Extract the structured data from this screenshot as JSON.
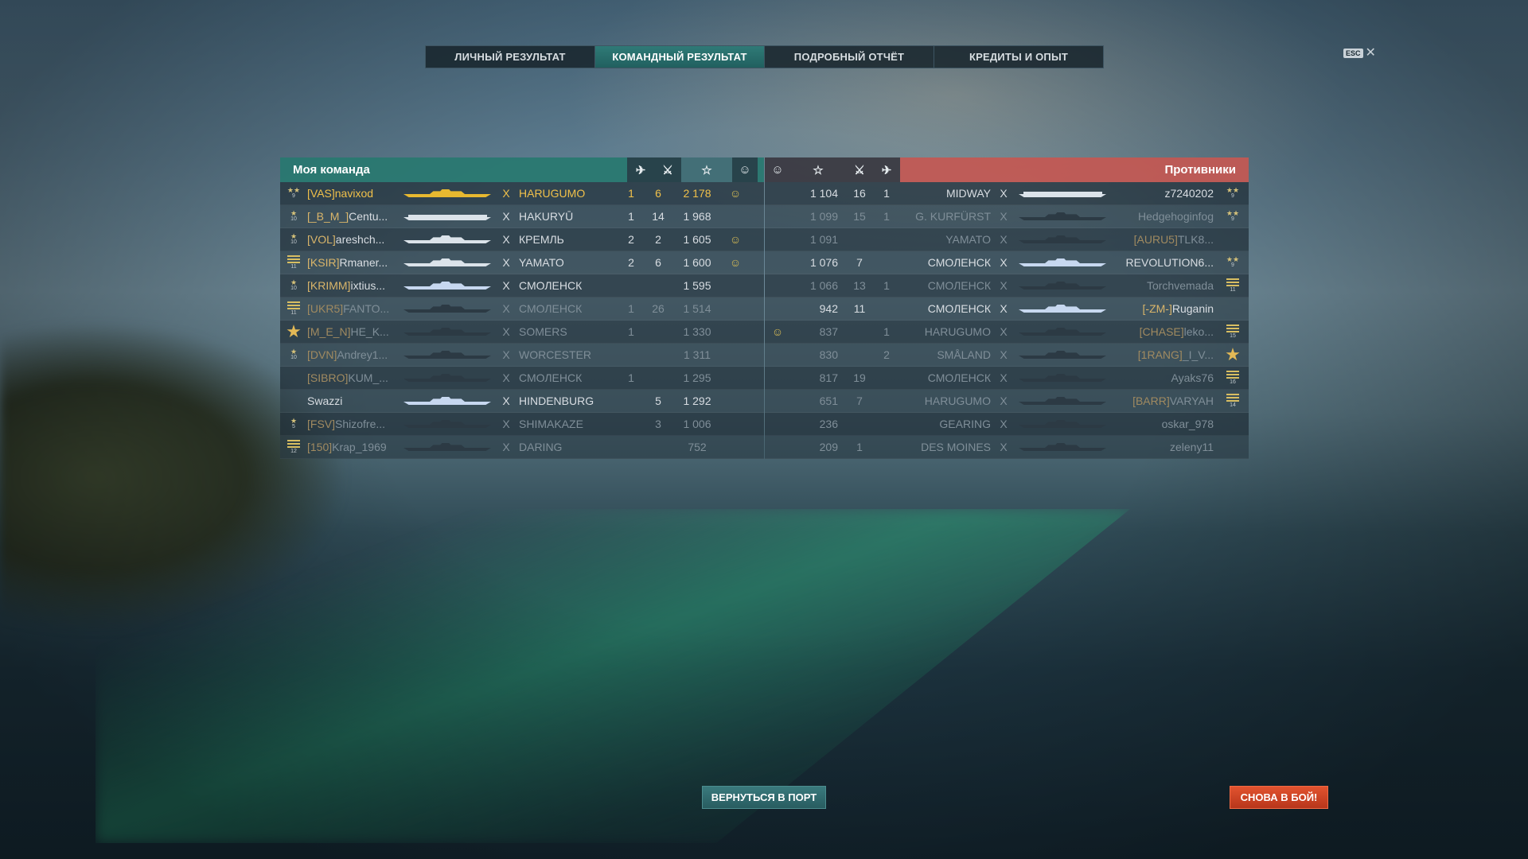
{
  "tabs": [
    "ЛИЧНЫЙ РЕЗУЛЬТАТ",
    "КОМАНДНЫЙ РЕЗУЛЬТАТ",
    "ПОДРОБНЫЙ ОТЧЁТ",
    "КРЕДИТЫ И ОПЫТ"
  ],
  "active_tab": 1,
  "esc_label": "ESC",
  "my_team": {
    "title": "Моя команда",
    "rows": [
      {
        "rank": "9",
        "rank_type": "stars2",
        "clan": "[VAS]",
        "player": "navixod",
        "sil": "gold",
        "x": "X",
        "ship": "HARUGUMO",
        "planes": "1",
        "kills": "6",
        "xp": "2 178",
        "base": true,
        "state": "me"
      },
      {
        "rank": "10",
        "rank_type": "star",
        "clan": "[_B_M_]",
        "player": "Centu...",
        "sil": "carrier",
        "x": "X",
        "ship": "HAKURYŪ",
        "planes": "1",
        "kills": "14",
        "xp": "1 968",
        "base": false,
        "state": "alive"
      },
      {
        "rank": "10",
        "rank_type": "star",
        "clan": "[VOL]",
        "player": "areshch...",
        "sil": "light",
        "x": "X",
        "ship": "КРЕМЛЬ",
        "planes": "2",
        "kills": "2",
        "xp": "1 605",
        "base": true,
        "state": "alive"
      },
      {
        "rank": "11",
        "rank_type": "bars",
        "clan": "[KSIR]",
        "player": "Rmaner...",
        "sil": "light",
        "x": "X",
        "ship": "YAMATO",
        "planes": "2",
        "kills": "6",
        "xp": "1 600",
        "base": true,
        "state": "alive"
      },
      {
        "rank": "10",
        "rank_type": "star",
        "clan": "[KRIMM]",
        "player": "ixtius...",
        "sil": "blue",
        "x": "X",
        "ship": "СМОЛЕНСК",
        "planes": "",
        "kills": "",
        "xp": "1 595",
        "base": false,
        "state": "alive"
      },
      {
        "rank": "11",
        "rank_type": "bars",
        "clan": "[UKR5]",
        "player": "FANTO...",
        "sil": "dark",
        "x": "X",
        "ship": "СМОЛЕНСК",
        "planes": "1",
        "kills": "26",
        "xp": "1 514",
        "base": false,
        "state": "dead"
      },
      {
        "rank": "",
        "rank_type": "big",
        "clan": "[M_E_N]",
        "player": "HE_K...",
        "sil": "dark",
        "x": "X",
        "ship": "SOMERS",
        "planes": "1",
        "kills": "",
        "xp": "1 330",
        "base": false,
        "state": "dead"
      },
      {
        "rank": "10",
        "rank_type": "star",
        "clan": "[DVN]",
        "player": "Andrey1...",
        "sil": "dark",
        "x": "X",
        "ship": "WORCESTER",
        "planes": "",
        "kills": "",
        "xp": "1 311",
        "base": false,
        "state": "dead"
      },
      {
        "rank": "",
        "rank_type": "none",
        "clan": "[SIBRO]",
        "player": "KUM_...",
        "sil": "dark",
        "x": "X",
        "ship": "СМОЛЕНСК",
        "planes": "1",
        "kills": "",
        "xp": "1 295",
        "base": false,
        "state": "dead"
      },
      {
        "rank": "",
        "rank_type": "none",
        "clan": "",
        "player": "Swazzi",
        "sil": "blue",
        "x": "X",
        "ship": "HINDENBURG",
        "planes": "",
        "kills": "5",
        "xp": "1 292",
        "base": false,
        "state": "alive"
      },
      {
        "rank": "5",
        "rank_type": "star",
        "clan": "[FSV]",
        "player": "Shizofre...",
        "sil": "dark",
        "x": "X",
        "ship": "SHIMAKAZE",
        "planes": "",
        "kills": "3",
        "xp": "1 006",
        "base": false,
        "state": "dead"
      },
      {
        "rank": "12",
        "rank_type": "bars",
        "clan": "[150]",
        "player": "Krap_1969",
        "sil": "dark",
        "x": "X",
        "ship": "DARING",
        "planes": "",
        "kills": "",
        "xp": "752",
        "base": false,
        "state": "dead"
      }
    ]
  },
  "enemies": {
    "title": "Противники",
    "rows": [
      {
        "base": false,
        "xp": "1 104",
        "kills": "16",
        "planes": "1",
        "ship": "MIDWAY",
        "x": "X",
        "sil": "carrier",
        "clan": "",
        "player": "z7240202",
        "rank": "9",
        "rank_type": "stars2",
        "state": "alive"
      },
      {
        "base": false,
        "xp": "1 099",
        "kills": "15",
        "planes": "1",
        "ship": "G. KURFÜRST",
        "x": "X",
        "sil": "dark",
        "clan": "",
        "player": "Hedgehoginfog",
        "rank": "9",
        "rank_type": "stars2",
        "state": "dead"
      },
      {
        "base": false,
        "xp": "1 091",
        "kills": "",
        "planes": "",
        "ship": "YAMATO",
        "x": "X",
        "sil": "dark",
        "clan": "[AURU5]",
        "player": "TLK8...",
        "rank": "",
        "rank_type": "none",
        "state": "dead"
      },
      {
        "base": false,
        "xp": "1 076",
        "kills": "7",
        "planes": "",
        "ship": "СМОЛЕНСК",
        "x": "X",
        "sil": "blue",
        "clan": "",
        "player": "REVOLUTION6...",
        "rank": "9",
        "rank_type": "stars2",
        "state": "alive"
      },
      {
        "base": false,
        "xp": "1 066",
        "kills": "13",
        "planes": "1",
        "ship": "СМОЛЕНСК",
        "x": "X",
        "sil": "dark",
        "clan": "",
        "player": "Torchvemada",
        "rank": "11",
        "rank_type": "bars",
        "state": "dead"
      },
      {
        "base": false,
        "xp": "942",
        "kills": "11",
        "planes": "",
        "ship": "СМОЛЕНСК",
        "x": "X",
        "sil": "blue",
        "clan": "[-ZM-]",
        "player": "Ruganin",
        "rank": "",
        "rank_type": "none",
        "state": "alive"
      },
      {
        "base": true,
        "xp": "837",
        "kills": "",
        "planes": "1",
        "ship": "HARUGUMO",
        "x": "X",
        "sil": "dark",
        "clan": "[CHASE]",
        "player": "leko...",
        "rank": "15",
        "rank_type": "bars",
        "state": "dead"
      },
      {
        "base": false,
        "xp": "830",
        "kills": "",
        "planes": "2",
        "ship": "SMÅLAND",
        "x": "X",
        "sil": "dark",
        "clan": "[1RANG]",
        "player": "_I_V...",
        "rank": "",
        "rank_type": "big",
        "state": "dead"
      },
      {
        "base": false,
        "xp": "817",
        "kills": "19",
        "planes": "",
        "ship": "СМОЛЕНСК",
        "x": "X",
        "sil": "dark",
        "clan": "",
        "player": "Ayaks76",
        "rank": "16",
        "rank_type": "bars",
        "state": "dead"
      },
      {
        "base": false,
        "xp": "651",
        "kills": "7",
        "planes": "",
        "ship": "HARUGUMO",
        "x": "X",
        "sil": "dark",
        "clan": "[BARR]",
        "player": "VARYAH",
        "rank": "14",
        "rank_type": "bars",
        "state": "dead"
      },
      {
        "base": false,
        "xp": "236",
        "kills": "",
        "planes": "",
        "ship": "GEARING",
        "x": "X",
        "sil": "dark",
        "clan": "",
        "player": "oskar_978",
        "rank": "",
        "rank_type": "none",
        "state": "dead"
      },
      {
        "base": false,
        "xp": "209",
        "kills": "1",
        "planes": "",
        "ship": "DES MOINES",
        "x": "X",
        "sil": "dark",
        "clan": "",
        "player": "zeleny11",
        "rank": "",
        "rank_type": "none",
        "state": "dead"
      }
    ]
  },
  "icons": {
    "planes": "plane-icon",
    "kills": "crossed-swords-icon",
    "xp": "star-icon",
    "base": "base-capture-icon"
  },
  "buttons": {
    "port": "ВЕРНУТЬСЯ В ПОРТ",
    "again": "СНОВА В БОЙ!"
  },
  "colors": {
    "my_team": "#287870",
    "enemies": "#c45852",
    "highlight": "#f0c04a",
    "again_button": "#d84427"
  }
}
